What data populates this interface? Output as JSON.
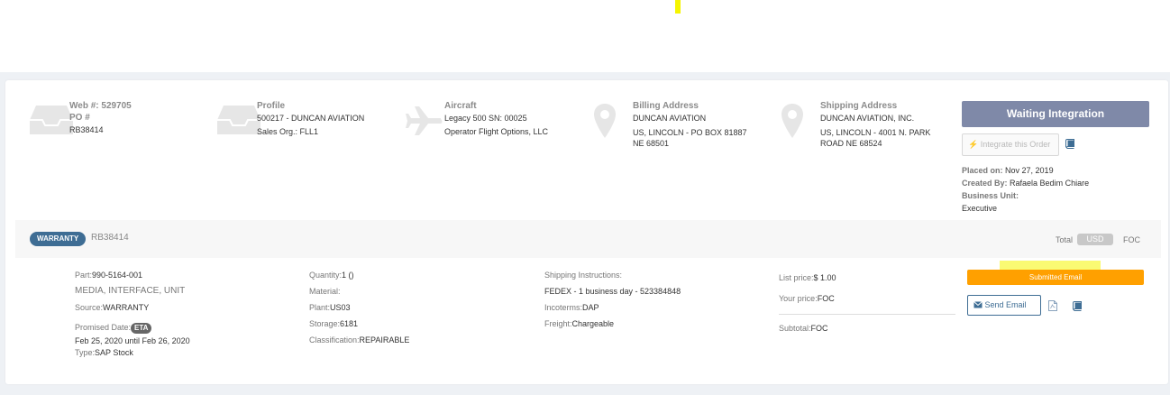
{
  "header": {
    "web": {
      "title": "Web #: 529705",
      "subtitle": "PO #",
      "value": "RB38414"
    },
    "profile": {
      "title": "Profile",
      "line1": "500217 - DUNCAN AVIATION",
      "line2": "Sales Org.: FLL1"
    },
    "aircraft": {
      "title": "Aircraft",
      "line1": "Legacy 500 SN: 00025",
      "line2": "Operator Flight Options, LLC"
    },
    "billing": {
      "title": "Billing Address",
      "line1": "DUNCAN AVIATION",
      "line2": "US, LINCOLN - PO BOX 81887",
      "line3": "NE 68501"
    },
    "shipping": {
      "title": "Shipping Address",
      "line1": "DUNCAN AVIATION, INC.",
      "line2": "US, LINCOLN - 4001 N. PARK",
      "line3": "ROAD NE 68524"
    },
    "status_label": "Waiting Integration",
    "integrate_label": "Integrate this Order",
    "placed_on_label": "Placed on:",
    "placed_on_value": "Nov 27, 2019",
    "created_by_label": "Created By:",
    "created_by_value": "Rafaela Bedim Chiare",
    "business_unit_label": "Business Unit:",
    "business_unit_value": "Executive"
  },
  "order": {
    "badge": "WARRANTY",
    "number": "RB38414",
    "total_label": "Total",
    "currency": "USD",
    "total_value": "FOC"
  },
  "item": {
    "part_label": "Part:",
    "part_value": "990-5164-001",
    "description": "MEDIA, INTERFACE, UNIT",
    "source_label": "Source:",
    "source_value": "WARRANTY",
    "promised_label": "Promised Date:",
    "eta": "ETA",
    "promised_range": "Feb 25, 2020 until Feb 26, 2020",
    "type_label": "Type:",
    "type_value": "SAP Stock",
    "quantity_label": "Quantity:",
    "quantity_value": "1 ()",
    "material_label": "Material:",
    "plant_label": "Plant:",
    "plant_value": "US03",
    "storage_label": "Storage:",
    "storage_value": "6181",
    "classification_label": "Classification:",
    "classification_value": "REPAIRABLE",
    "shipping_instr_label": "Shipping Instructions:",
    "shipping_instr_value": "FEDEX - 1 business day - 523384848",
    "incoterms_label": "Incoterms:",
    "incoterms_value": "DAP",
    "freight_label": "Freight:",
    "freight_value": "Chargeable",
    "list_price_label": "List price:",
    "list_price_value": "$ 1.00",
    "your_price_label": "Your price:",
    "your_price_value": "FOC",
    "subtotal_label": "Subtotal:",
    "subtotal_value": "FOC",
    "submitted_email": "Submitted Email",
    "send_email": "Send Email"
  },
  "icons": [
    "inbox-icon",
    "inbox-icon",
    "airplane-icon",
    "map-pin-icon",
    "map-pin-icon",
    "bolt-icon",
    "book-icon",
    "envelope-icon",
    "pdf-icon",
    "book-icon"
  ],
  "colors": {
    "status": "#7f89a8",
    "warranty": "#3e6d94",
    "submitted": "#ffa000",
    "page_bg": "#eef1f5"
  }
}
